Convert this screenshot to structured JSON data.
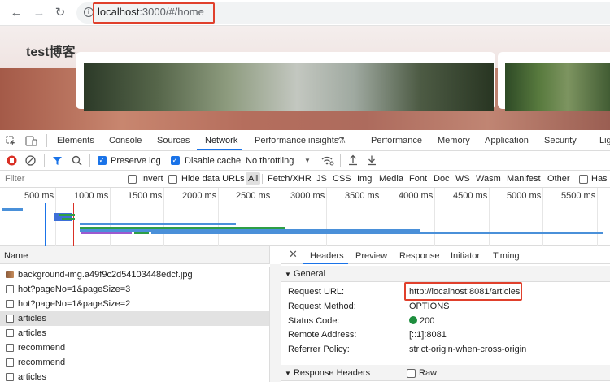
{
  "browser": {
    "url_host": "localhost",
    "url_rest": ":3000/#/home"
  },
  "page": {
    "site_title": "test博客"
  },
  "devtools": {
    "tabs": [
      "Elements",
      "Console",
      "Sources",
      "Network",
      "Performance insights",
      "Performance",
      "Memory",
      "Application",
      "Security",
      "Lig"
    ],
    "active_tab": "Network",
    "toolbar": {
      "preserve_log": "Preserve log",
      "disable_cache": "Disable cache",
      "throttling": "No throttling"
    },
    "filter": {
      "placeholder": "Filter",
      "invert": "Invert",
      "hide_data_urls": "Hide data URLs",
      "types": [
        "All",
        "Fetch/XHR",
        "JS",
        "CSS",
        "Img",
        "Media",
        "Font",
        "Doc",
        "WS",
        "Wasm",
        "Manifest",
        "Other"
      ],
      "has_blocked": "Has l"
    },
    "timeline_ticks": [
      "500 ms",
      "1000 ms",
      "1500 ms",
      "2000 ms",
      "2500 ms",
      "3000 ms",
      "3500 ms",
      "4000 ms",
      "4500 ms",
      "5000 ms",
      "5500 ms"
    ],
    "name_column": "Name",
    "requests": [
      {
        "name": "background-img.a49f9c2d54103448edcf.jpg",
        "type": "img"
      },
      {
        "name": "hot?pageNo=1&pageSize=3",
        "type": "doc"
      },
      {
        "name": "hot?pageNo=1&pageSize=2",
        "type": "doc"
      },
      {
        "name": "articles",
        "type": "doc",
        "selected": true
      },
      {
        "name": "articles",
        "type": "doc"
      },
      {
        "name": "recommend",
        "type": "doc"
      },
      {
        "name": "recommend",
        "type": "doc"
      },
      {
        "name": "articles",
        "type": "doc"
      }
    ],
    "detail_tabs": [
      "Headers",
      "Preview",
      "Response",
      "Initiator",
      "Timing"
    ],
    "active_detail_tab": "Headers",
    "general_section": "General",
    "general": [
      {
        "key": "Request URL:",
        "value": "http://localhost:8081/articles"
      },
      {
        "key": "Request Method:",
        "value": "OPTIONS"
      },
      {
        "key": "Status Code:",
        "value": "200"
      },
      {
        "key": "Remote Address:",
        "value": "[::1]:8081"
      },
      {
        "key": "Referrer Policy:",
        "value": "strict-origin-when-cross-origin"
      }
    ],
    "response_headers_section": "Response Headers",
    "raw_label": "Raw"
  },
  "colors": {
    "accent": "#1a73e8",
    "highlight_box": "#e0402c",
    "status_ok": "#1e8e3e"
  }
}
